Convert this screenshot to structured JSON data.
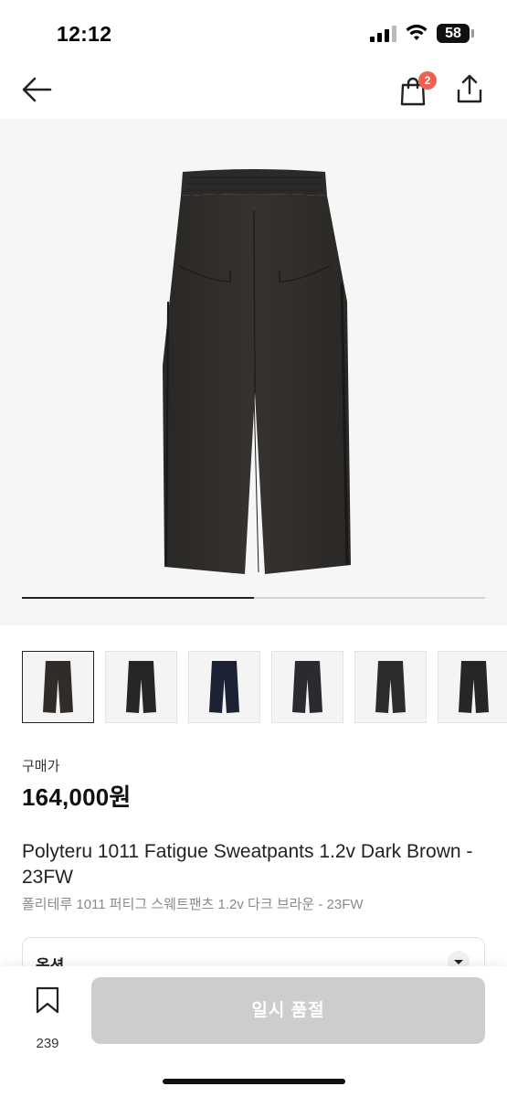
{
  "status_bar": {
    "time": "12:12",
    "battery": "58"
  },
  "nav": {
    "cart_count": "2",
    "icons": [
      "back-arrow-icon",
      "shopping-bag-icon",
      "share-icon"
    ]
  },
  "gallery": {
    "progress": 0.5,
    "thumbnail_count": 6,
    "thumbnail_colors": [
      "#2f2c2a",
      "#262626",
      "#1c2133",
      "#2a2b2e",
      "#2c2c2c",
      "#262626"
    ]
  },
  "product": {
    "price_label": "구매가",
    "price": "164,000원",
    "title": "Polyteru 1011 Fatigue Sweatpants 1.2v Dark Brown - 23FW",
    "subtitle": "폴리테루 1011 퍼티그 스웨트팬츠 1.2v 다크 브라운 - 23FW"
  },
  "option": {
    "label": "옵션"
  },
  "bottom_bar": {
    "save_count": "239",
    "buy_label": "일시 품절"
  },
  "colors": {
    "accent_badge": "#ef6253",
    "disabled_button": "#cdcdcd"
  }
}
